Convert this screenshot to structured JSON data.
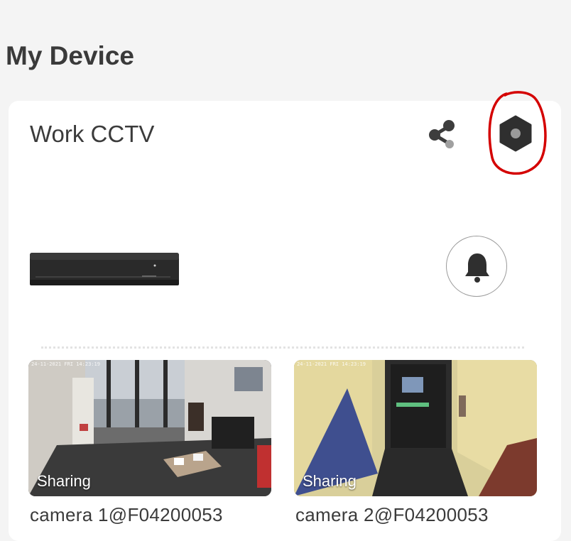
{
  "page": {
    "title": "My Device"
  },
  "device": {
    "name": "Work CCTV",
    "share_icon": "share-icon",
    "settings_icon": "hexagon-settings-icon",
    "settings_highlight_color": "#e00000",
    "alarm_icon": "bell-icon"
  },
  "cameras": [
    {
      "badge": "Sharing",
      "label": "camera 1@F04200053",
      "timestamp": "24-11-2021 FRI 14:23:19"
    },
    {
      "badge": "Sharing",
      "label": "camera 2@F04200053",
      "timestamp": "24-11-2021 FRI 14:23:19"
    }
  ],
  "colors": {
    "background": "#f4f4f4",
    "card": "#ffffff",
    "text": "#3b3b3b"
  }
}
